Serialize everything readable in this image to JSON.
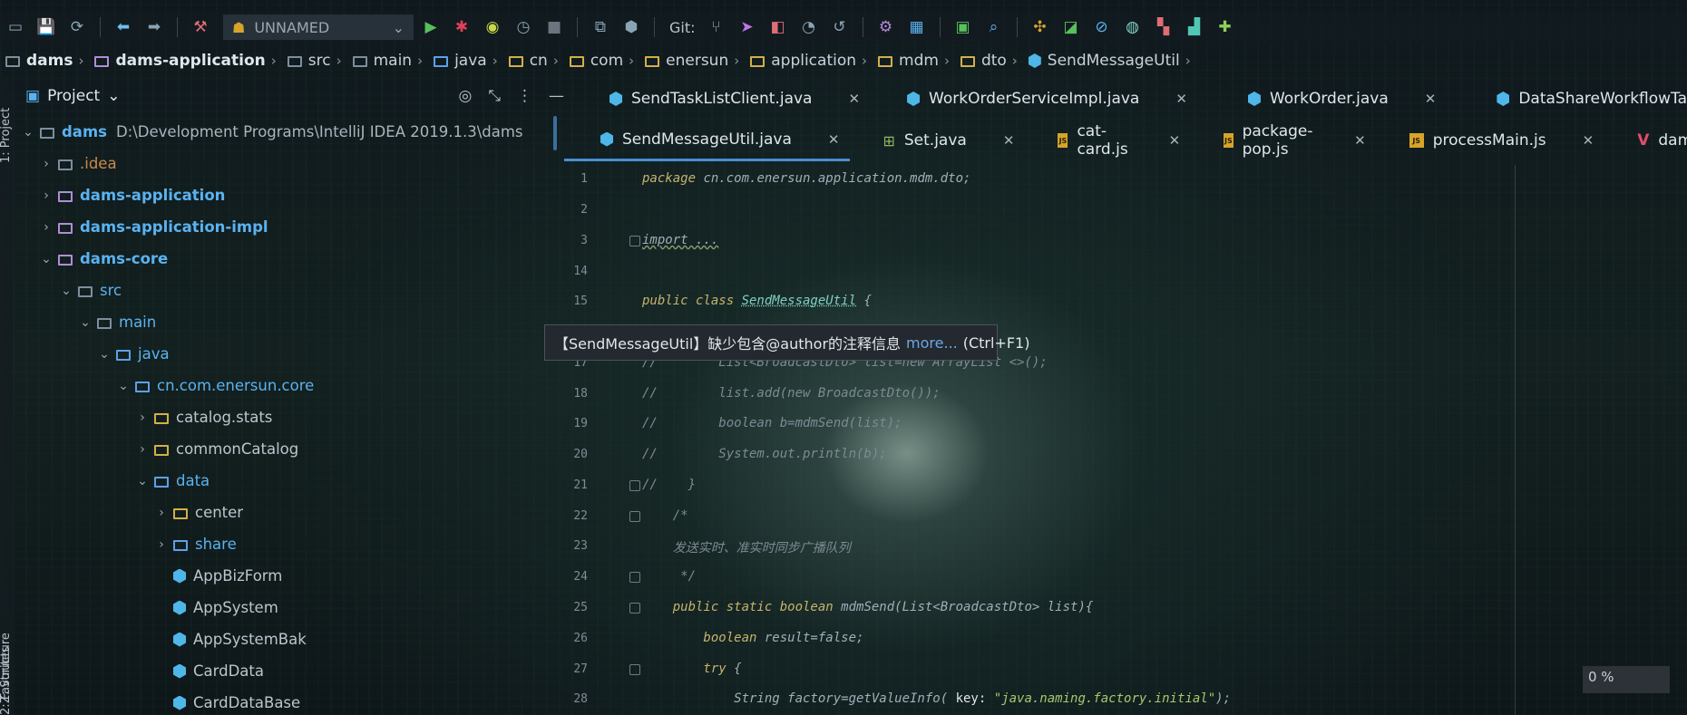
{
  "toolbar": {
    "run_config": "UNNAMED",
    "git_label": "Git:"
  },
  "breadcrumb": [
    "dams",
    "dams-application",
    "src",
    "main",
    "java",
    "cn",
    "com",
    "enersun",
    "application",
    "mdm",
    "dto",
    "SendMessageUtil"
  ],
  "side_labels": {
    "project": "1: Project",
    "structure": "Z: Structure",
    "favorites": "2: Favorites"
  },
  "project_panel": {
    "title": "Project",
    "tree": [
      {
        "label": "dams",
        "path": "D:\\Development Programs\\IntelliJ IDEA 2019.1.3\\dams"
      },
      {
        "label": ".idea"
      },
      {
        "label": "dams-application"
      },
      {
        "label": "dams-application-impl"
      },
      {
        "label": "dams-core"
      },
      {
        "label": "src"
      },
      {
        "label": "main"
      },
      {
        "label": "java"
      },
      {
        "label": "cn.com.enersun.core"
      },
      {
        "label": "catalog.stats"
      },
      {
        "label": "commonCatalog"
      },
      {
        "label": "data"
      },
      {
        "label": "center"
      },
      {
        "label": "share"
      },
      {
        "label": "AppBizForm"
      },
      {
        "label": "AppSystem"
      },
      {
        "label": "AppSystemBak"
      },
      {
        "label": "CardData"
      },
      {
        "label": "CardDataBase"
      }
    ]
  },
  "tabs_row1": [
    "SendTaskListClient.java",
    "WorkOrderServiceImpl.java",
    "WorkOrder.java",
    "DataShareWorkflowTable.java"
  ],
  "tabs_row2": [
    "SendMessageUtil.java",
    "Set.java",
    "cat-card.js",
    "package-pop.js",
    "processMain.js",
    "dams"
  ],
  "editor": {
    "line_numbers": [
      "1",
      "2",
      "3",
      "14",
      "15",
      "17",
      "18",
      "19",
      "20",
      "21",
      "22",
      "23",
      "24",
      "25",
      "26",
      "27",
      "28"
    ],
    "code": {
      "l1_kw": "package",
      "l1_rest": " cn.com.enersun.application.mdm.dto;",
      "l3": "import ...",
      "l15_kw": "public class ",
      "l15_cls": "SendMessageUtil",
      "l15_rest": " {",
      "l17": "//        List<BroadcastDto> list=new ArrayList <>();",
      "l18": "//        list.add(new BroadcastDto());",
      "l19": "//        boolean b=mdmSend(list);",
      "l20": "//        System.out.println(b);",
      "l21": "//    }",
      "l22": "    /*",
      "l23": "    发送实时、准实时同步广播队列",
      "l24": "     */",
      "l25_kw": "    public static boolean ",
      "l25_rest": "mdmSend(List<BroadcastDto> list){",
      "l26_kw": "        boolean ",
      "l26_rest": "result=false;",
      "l27_kw": "        try ",
      "l27_rest": "{",
      "l28_pre": "            String factory=getValueInfo( ",
      "l28_hint": "key: ",
      "l28_str": "\"java.naming.factory.initial\"",
      "l28_post": ");"
    },
    "tooltip": {
      "text": "【SendMessageUtil】缺少包含@author的注释信息",
      "link": "more...",
      "shortcut": "(Ctrl+F1)"
    }
  },
  "progress": "0 %"
}
